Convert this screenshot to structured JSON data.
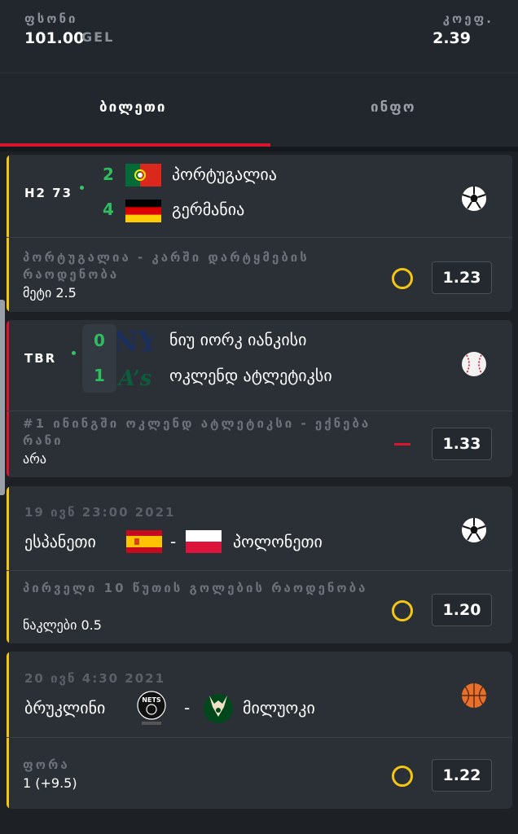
{
  "header": {
    "stake_label": "ფსონი",
    "stake_value": "101.00",
    "currency": "GEL",
    "odds_label": "კოეფ.",
    "odds_value": "2.39"
  },
  "tabs": [
    {
      "label": "ბილეთი",
      "active": true
    },
    {
      "label": "ინფო",
      "active": false
    }
  ],
  "colors": {
    "accent_red": "#d8172e",
    "pending_yellow": "#f3c614",
    "score_green": "#2fbe5f"
  },
  "bets": [
    {
      "status": "H2 73",
      "sport_icon": "soccer-ball-icon",
      "team1": {
        "score": "2",
        "name": "პორტუგალია",
        "flag": "portugal-flag-icon"
      },
      "team2": {
        "score": "4",
        "name": "გერმანია",
        "flag": "germany-flag-icon"
      },
      "market": "პორტუგალია - კარში დარტყმების რაოდენობა",
      "selection": "მეტი 2.5",
      "state": "pending",
      "odds": "1.23"
    },
    {
      "status": "TBR",
      "sport_icon": "baseball-icon",
      "team1": {
        "score": "0",
        "name": "ნიუ იორკ იანკისი",
        "logo": "yankees-logo-icon"
      },
      "team2": {
        "score": "1",
        "name": "ოკლენდ ატლეტიკსი",
        "logo": "athletics-logo-icon"
      },
      "market": "#1 ინინგში ოკლენდ ატლეტიკსი - ექნება რანი",
      "selection": "არა",
      "state": "lost",
      "odds": "1.33"
    },
    {
      "date": "19 ივნ 23:00 2021",
      "sport_icon": "soccer-ball-icon",
      "team1": {
        "name": "ესპანეთი",
        "flag": "spain-flag-icon"
      },
      "team2": {
        "name": "პოლონეთი",
        "flag": "poland-flag-icon"
      },
      "separator": "-",
      "market": "პირველი 10 წუთის გოლების რაოდენობა",
      "selection": "ნაკლები 0.5",
      "state": "pending",
      "odds": "1.20"
    },
    {
      "date": "20 ივნ 4:30 2021",
      "sport_icon": "basketball-icon",
      "team1": {
        "name": "ბრუკლინი",
        "logo": "nets-logo-icon",
        "logo_text": "NETS"
      },
      "team2": {
        "name": "მილუოკი",
        "logo": "bucks-logo-icon"
      },
      "separator": "-",
      "market": "ფორა",
      "selection": "1 (+9.5)",
      "state": "pending",
      "odds": "1.22"
    }
  ]
}
